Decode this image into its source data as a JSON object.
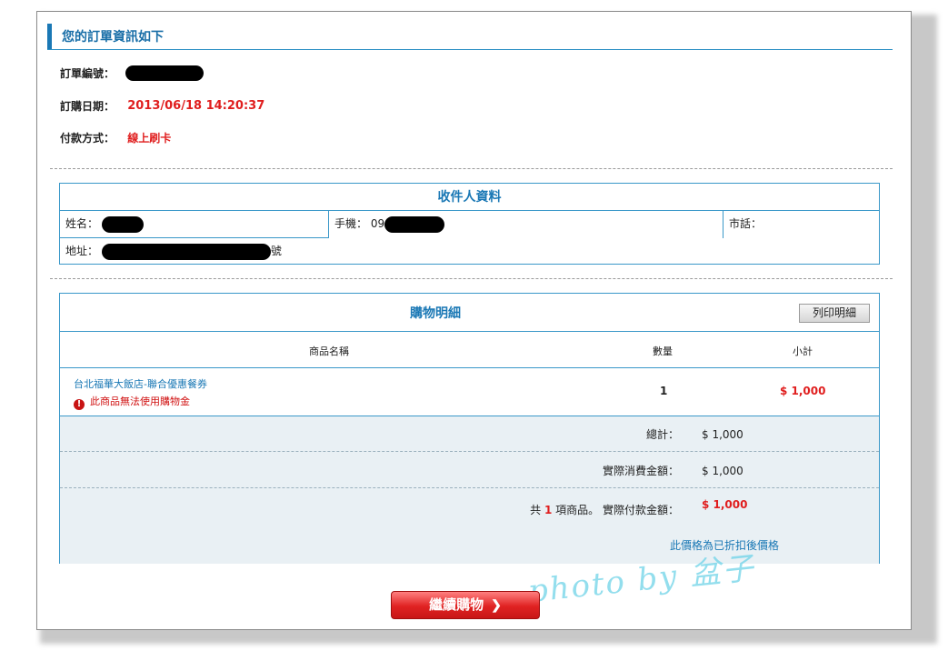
{
  "order": {
    "section_title": "您的訂單資訊如下",
    "number_label": "訂單編號：",
    "date_label": "訂購日期：",
    "date_value": "2013/06/18 14:20:37",
    "payment_label": "付款方式：",
    "payment_value": "線上刷卡"
  },
  "recipient": {
    "title": "收件人資料",
    "name_label": "姓名：",
    "mobile_label": "手機：",
    "mobile_prefix": "09",
    "phone_label": "市話：",
    "address_label": "地址：",
    "address_suffix": "號"
  },
  "shopping": {
    "title": "購物明細",
    "print_button": "列印明細",
    "columns": {
      "name": "商品名稱",
      "qty": "數量",
      "subtotal": "小計"
    },
    "items": [
      {
        "name": "台北福華大飯店-聯合優惠餐券",
        "warning": "此商品無法使用購物金",
        "qty": "1",
        "subtotal": "$ 1,000"
      }
    ],
    "total_label": "總計：",
    "total_value": "$ 1,000",
    "actual_spend_label": "實際消費金額：",
    "actual_spend_value": "$ 1,000",
    "count_prefix": "共",
    "count_value": "1",
    "count_suffix": "項商品。",
    "actual_pay_label": "實際付款金額：",
    "actual_pay_value": "$ 1,000",
    "note": "此價格為已折扣後價格"
  },
  "continue_button": "繼續購物",
  "watermark": "photo by 盆子",
  "colors": {
    "accent": "#1a78b5",
    "price_red": "#e01e1e",
    "summary_bg": "#e9f0f4"
  }
}
